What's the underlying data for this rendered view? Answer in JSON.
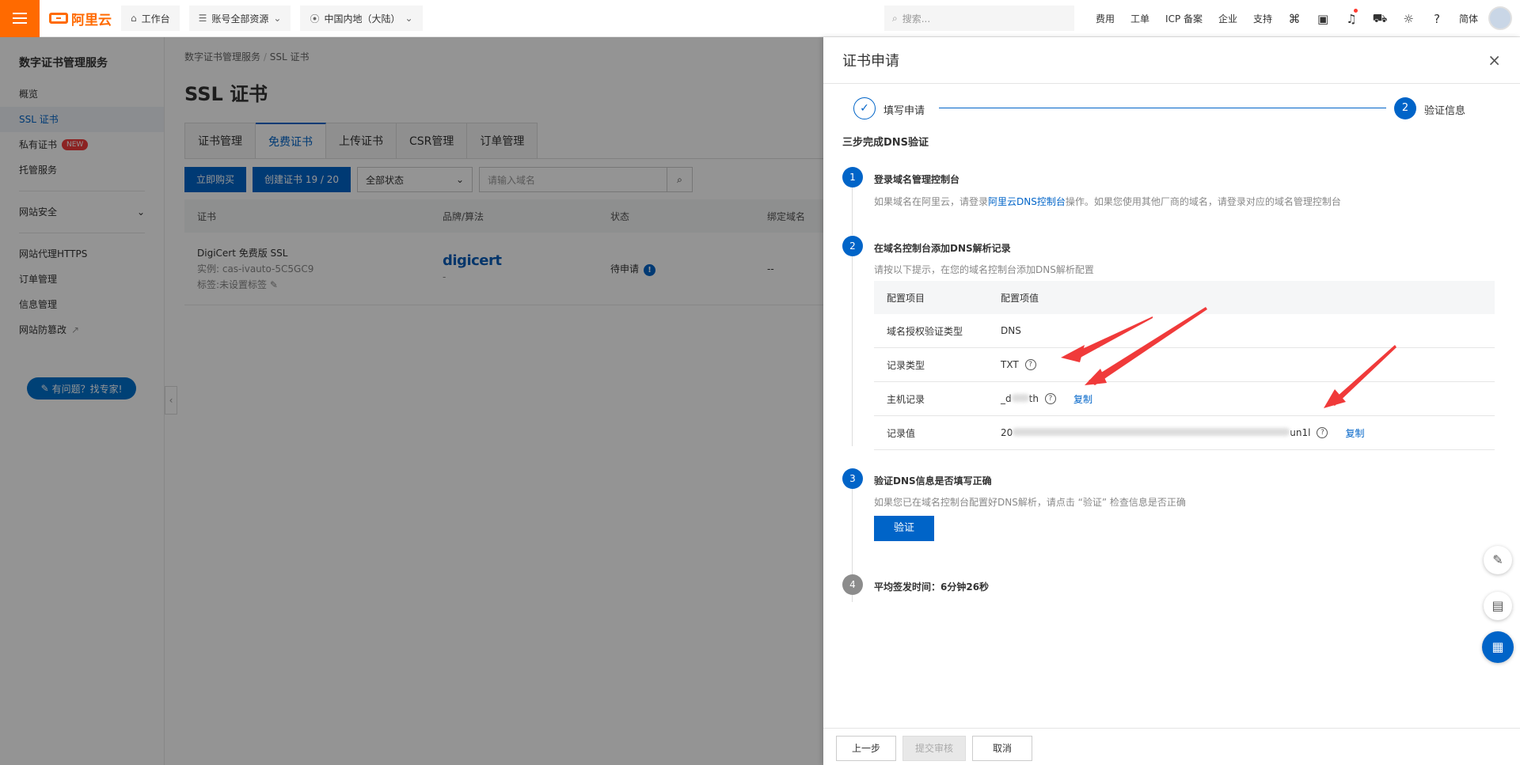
{
  "topbar": {
    "brand": "阿里云",
    "workbench": "工作台",
    "resources": "账号全部资源",
    "region": "中国内地（大陆）",
    "search_placeholder": "搜索...",
    "links": [
      "费用",
      "工单",
      "ICP 备案",
      "企业",
      "支持"
    ],
    "lang": "简体"
  },
  "sidebar": {
    "title": "数字证书管理服务",
    "items": [
      {
        "label": "概览"
      },
      {
        "label": "SSL 证书"
      },
      {
        "label": "私有证书",
        "badge": "NEW"
      },
      {
        "label": "托管服务"
      }
    ],
    "group": "网站安全",
    "items2": [
      {
        "label": "网站代理HTTPS"
      },
      {
        "label": "订单管理"
      },
      {
        "label": "信息管理"
      },
      {
        "label": "网站防篡改"
      }
    ],
    "help": "有问题？找专家!"
  },
  "main": {
    "breadcrumb": [
      "数字证书管理服务",
      "SSL 证书"
    ],
    "title": "SSL 证书",
    "tabs": [
      "证书管理",
      "免费证书",
      "上传证书",
      "CSR管理",
      "订单管理"
    ],
    "buy": "立即购买",
    "create": "创建证书 19 / 20",
    "status_select": "全部状态",
    "domain_placeholder": "请输入域名",
    "columns": [
      "证书",
      "品牌/算法",
      "状态",
      "绑定域名"
    ],
    "row": {
      "name": "DigiCert 免费版 SSL",
      "instance": "实例: cas-ivauto-5C5GC9",
      "tag": "标签:未设置标签",
      "brand": "digicert",
      "algo": "-",
      "status": "待申请",
      "domain": "--"
    }
  },
  "drawer": {
    "title": "证书申请",
    "step1": "填写申请",
    "step2": "验证信息",
    "step2_num": "2",
    "heading": "三步完成DNS验证",
    "s1": {
      "num": "1",
      "title": "登录域名管理控制台",
      "desc_a": "如果域名在阿里云，请登录",
      "desc_link": "阿里云DNS控制台",
      "desc_b": "操作。如果您使用其他厂商的域名，请登录对应的域名管理控制台"
    },
    "s2": {
      "num": "2",
      "title": "在域名控制台添加DNS解析记录",
      "desc": "请按以下提示，在您的域名控制台添加DNS解析配置"
    },
    "table": {
      "h1": "配置项目",
      "h2": "配置项值",
      "rows": [
        {
          "k": "域名授权验证类型",
          "v": "DNS"
        },
        {
          "k": "记录类型",
          "v": "TXT"
        },
        {
          "k": "主机记录",
          "v_pre": "_d",
          "v_post": "th"
        },
        {
          "k": "记录值",
          "v_pre": "20",
          "v_post": "un1l"
        }
      ],
      "copy": "复制"
    },
    "s3": {
      "num": "3",
      "title": "验证DNS信息是否填写正确",
      "desc": "如果您已在域名控制台配置好DNS解析，请点击 “验证” 检查信息是否正确",
      "btn": "验证"
    },
    "s4": {
      "num": "4",
      "title": "平均签发时间：6分钟26秒"
    },
    "footer": {
      "prev": "上一步",
      "submit": "提交审核",
      "cancel": "取消"
    }
  },
  "colors": {
    "brand": "#ff6a00",
    "primary": "#0064c8",
    "arrow": "#f03a3a"
  }
}
